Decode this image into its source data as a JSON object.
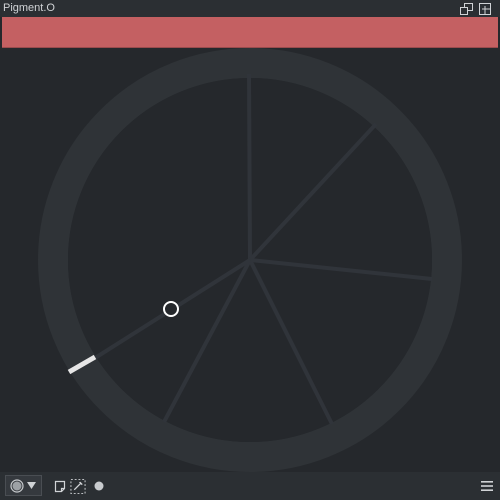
{
  "window": {
    "title": "Pigment.O"
  },
  "title_bar": {
    "icons": [
      "restore-window-icon",
      "close-icon"
    ]
  },
  "color_bar": {
    "color": "#c46062"
  },
  "wheel": {
    "ring_color": "#2f3337",
    "spoke_color": "#30343a",
    "selector_color": "#e6e6e6",
    "cursor_color": "#ffffff"
  },
  "bottom_bar": {
    "icons": [
      "color-circle-icon",
      "chevron-down-icon",
      "note-icon",
      "eyedropper-icon",
      "dot-icon",
      "menu-icon"
    ]
  }
}
